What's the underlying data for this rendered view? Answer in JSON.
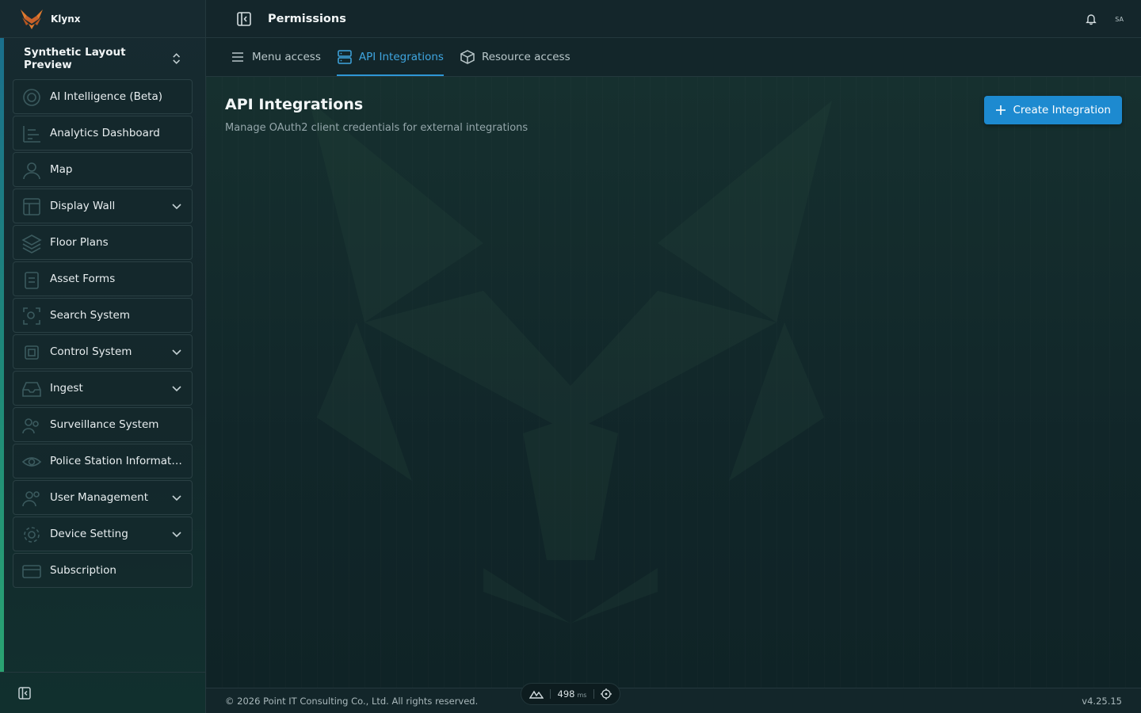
{
  "brand": {
    "name": "Klynx"
  },
  "project": {
    "name": "Synthetic Layout Preview"
  },
  "sidebar": {
    "items": [
      {
        "label": "AI Intelligence (Beta)",
        "icon": "target-icon",
        "expandable": false
      },
      {
        "label": "Analytics Dashboard",
        "icon": "chart-icon",
        "expandable": false
      },
      {
        "label": "Map",
        "icon": "user-pin-icon",
        "expandable": false
      },
      {
        "label": "Display Wall",
        "icon": "layout-icon",
        "expandable": true
      },
      {
        "label": "Floor Plans",
        "icon": "layers-icon",
        "expandable": false
      },
      {
        "label": "Asset Forms",
        "icon": "clipboard-icon",
        "expandable": false
      },
      {
        "label": "Search System",
        "icon": "scan-search-icon",
        "expandable": false
      },
      {
        "label": "Control System",
        "icon": "cpu-icon",
        "expandable": true
      },
      {
        "label": "Ingest",
        "icon": "inbox-icon",
        "expandable": true
      },
      {
        "label": "Surveillance System",
        "icon": "people-icon",
        "expandable": false
      },
      {
        "label": "Police Station Informati...",
        "icon": "eye-icon",
        "expandable": false
      },
      {
        "label": "User Management",
        "icon": "users-icon",
        "expandable": true
      },
      {
        "label": "Device Setting",
        "icon": "gear-icon",
        "expandable": true
      },
      {
        "label": "Subscription",
        "icon": "credit-card-icon",
        "expandable": false
      }
    ]
  },
  "header": {
    "title": "Permissions",
    "avatar_initials": "SA"
  },
  "tabs": [
    {
      "label": "Menu access",
      "icon": "menu-icon",
      "active": false
    },
    {
      "label": "API Integrations",
      "icon": "server-icon",
      "active": true
    },
    {
      "label": "Resource access",
      "icon": "box-icon",
      "active": false
    }
  ],
  "main": {
    "title": "API Integrations",
    "description": "Manage OAuth2 client credentials for external integrations",
    "create_label": "Create Integration"
  },
  "footer": {
    "copyright": "© 2026 Point IT Consulting Co., Ltd. All rights reserved.",
    "version": "v4.25.15",
    "perf_value": "498",
    "perf_unit": "ms"
  },
  "colors": {
    "accent": "#1d8ad0",
    "active_tab": "#3fa6e0",
    "logo": "#e07a2e"
  }
}
